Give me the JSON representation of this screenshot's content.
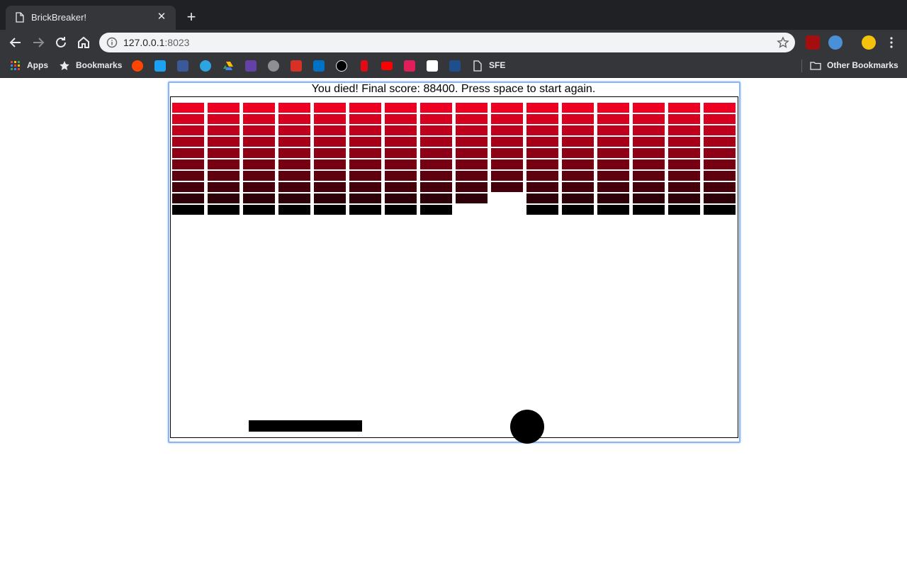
{
  "browser": {
    "tab_title": "BrickBreaker!",
    "tab_close": "✕",
    "new_tab": "+",
    "url_host": "127.0.0.1",
    "url_port": ":8023",
    "bookmarks_bar": {
      "apps_label": "Apps",
      "bookmarks_label": "Bookmarks",
      "sfe_label": "SFE",
      "other_label": "Other Bookmarks",
      "icons": [
        "reddit-icon",
        "twitter-icon",
        "facebook-icon",
        "telegram-icon",
        "drive-icon",
        "twitch-icon",
        "apple-icon",
        "gmail-icon",
        "outlook-icon",
        "github-icon",
        "netflix-icon",
        "youtube-icon",
        "slack-icon",
        "amazon-icon",
        "rl-icon"
      ]
    },
    "extensions": [
      "ublock-icon",
      "sync-icon",
      "profile-avatar"
    ]
  },
  "game": {
    "status_text": "You died! Final score: 88400. Press space to start again.",
    "brick_grid": {
      "columns": 16,
      "rows": 10,
      "row_colors": [
        "#ee0022",
        "#d6001f",
        "#be001c",
        "#a60018",
        "#8e0015",
        "#760011",
        "#5e000e",
        "#46000b",
        "#2e0007",
        "#000000"
      ],
      "missing": [
        [
          9,
          8
        ],
        [
          9,
          9
        ],
        [
          8,
          9
        ]
      ]
    },
    "paddle": {
      "label": "paddle"
    },
    "ball": {
      "label": "ball"
    }
  },
  "colors": {
    "chrome_dark": "#202124",
    "chrome_bar": "#35363a",
    "focus_ring": "#8ab4f8"
  }
}
